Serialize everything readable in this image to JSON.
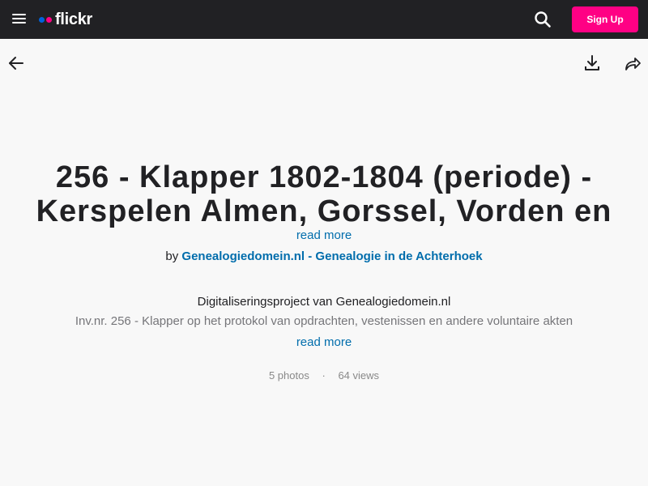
{
  "header": {
    "logo_text": "flickr",
    "signup_label": "Sign Up",
    "colors": {
      "background": "#212124",
      "brand_blue": "#0063dc",
      "brand_pink": "#ff0084"
    }
  },
  "toolbar": {
    "back_icon": "arrow-left-icon",
    "download_icon": "download-icon",
    "share_icon": "share-icon"
  },
  "album": {
    "title": "256 - Klapper 1802-1804 (periode) - Kerspelen Almen, Gorssel, Vorden en",
    "read_more_title": "read more",
    "by_label": "by",
    "owner": "Genealogiedomein.nl - Genealogie in de Achterhoek",
    "description_line1": "Digitaliseringsproject van Genealogiedomein.nl",
    "description_line2": "Inv.nr. 256 - Klapper op het protokol van opdrachten, vestenissen en andere voluntaire akten",
    "read_more_desc": "read more",
    "photos": "5 photos",
    "separator": "·",
    "views": "64 views"
  }
}
